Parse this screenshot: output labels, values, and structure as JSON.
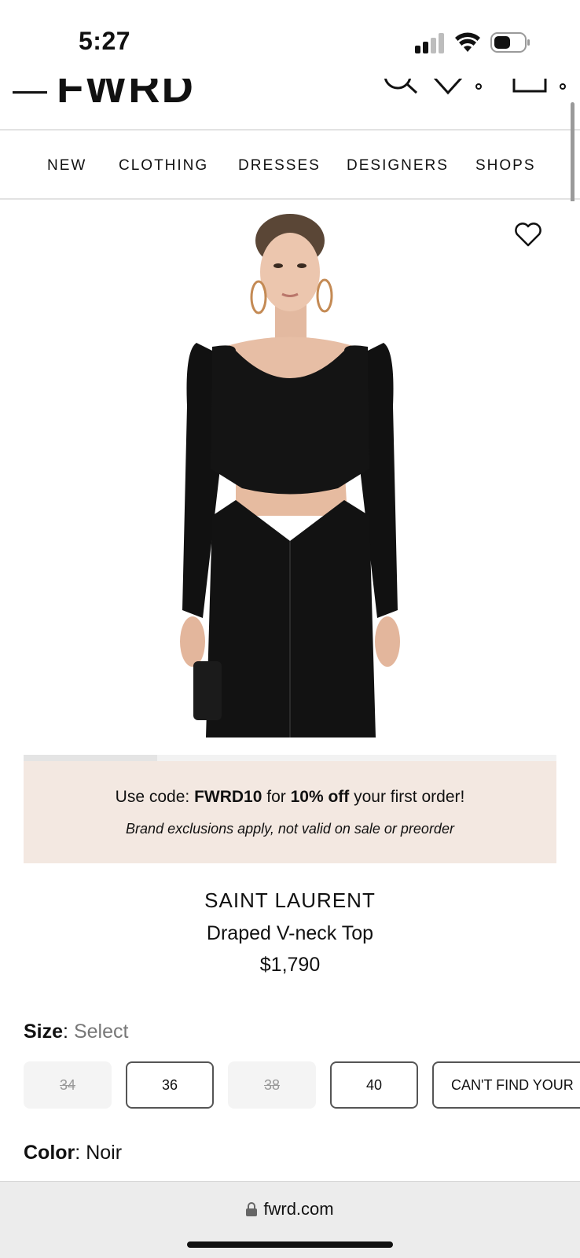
{
  "status_bar": {
    "time": "5:27"
  },
  "header": {
    "logo": "FWRD"
  },
  "nav": {
    "items": [
      {
        "label": "NEW"
      },
      {
        "label": "CLOTHING"
      },
      {
        "label": "DRESSES"
      },
      {
        "label": "DESIGNERS"
      },
      {
        "label": "SHOPS"
      }
    ]
  },
  "promo": {
    "line1_prefix": "Use code: ",
    "code": "FWRD10",
    "line1_mid": " for ",
    "discount": "10% off",
    "line1_suffix": " your first order!",
    "line2": "Brand exclusions apply, not valid on sale or preorder"
  },
  "product": {
    "brand": "SAINT LAURENT",
    "name": "Draped V-neck Top",
    "price": "$1,790"
  },
  "size": {
    "label": "Size",
    "separator": ": ",
    "value": "Select",
    "options": [
      {
        "label": "34",
        "available": false
      },
      {
        "label": "36",
        "available": true
      },
      {
        "label": "38",
        "available": false
      },
      {
        "label": "40",
        "available": true
      },
      {
        "label": "CAN'T FIND YOUR",
        "available": true
      }
    ]
  },
  "color": {
    "label": "Color",
    "separator": ": ",
    "value": "Noir"
  },
  "browser": {
    "url": "fwrd.com"
  },
  "icons": {
    "menu": "hamburger-icon",
    "search": "search-icon",
    "wishlist": "heart-icon",
    "bag": "shopping-bag-icon",
    "lock": "lock-icon"
  }
}
